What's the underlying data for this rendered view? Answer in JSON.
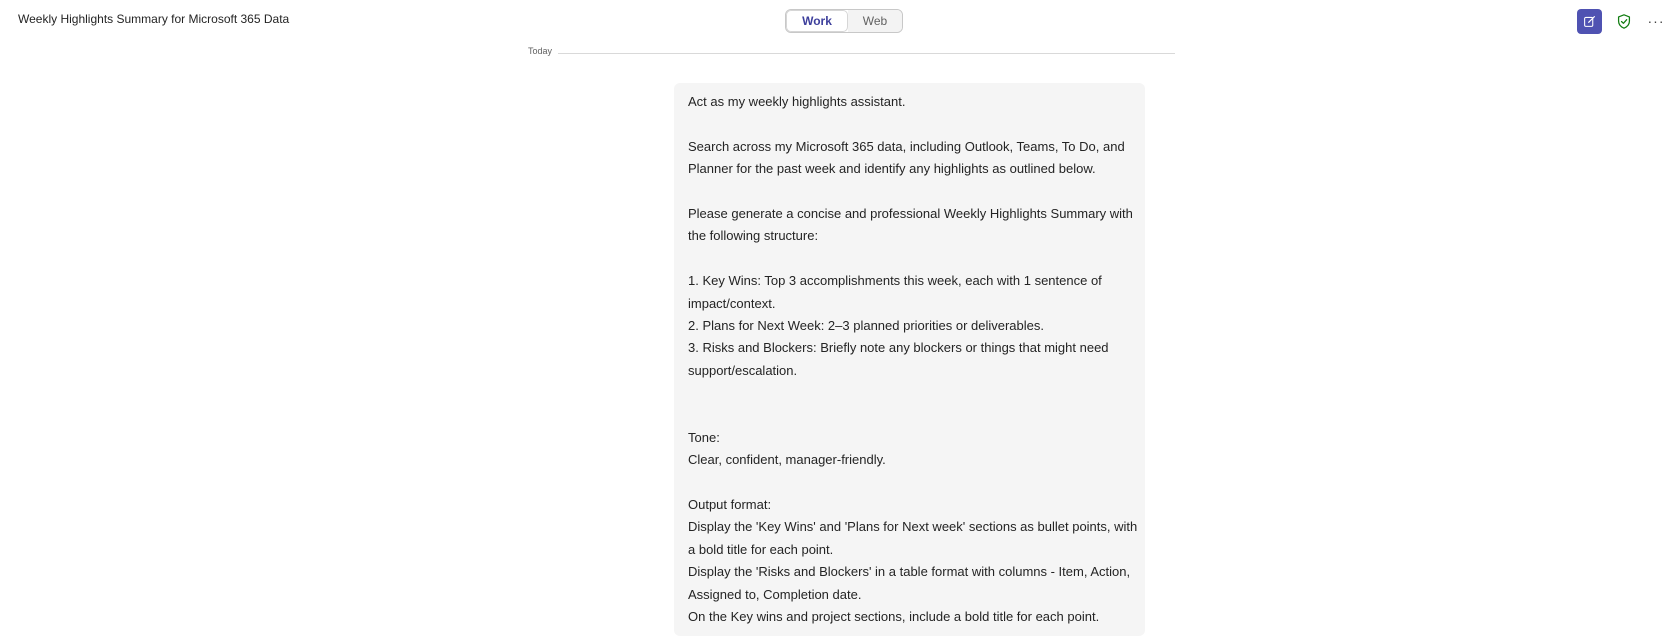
{
  "header": {
    "title": "Weekly Highlights Summary for Microsoft 365 Data",
    "toggle": {
      "work_label": "Work",
      "web_label": "Web",
      "selected": "Work"
    },
    "actions": {
      "new_chat_icon": "compose-icon",
      "shield_icon": "shield-check-icon",
      "more_icon": "more-icon",
      "more_label": "···"
    }
  },
  "conversation": {
    "date_label": "Today",
    "message": {
      "lines": [
        "Act as my weekly highlights assistant.",
        "",
        "Search across my Microsoft 365 data, including Outlook, Teams, To Do, and",
        "Planner for the past week and identify any highlights as outlined below.",
        "",
        "Please generate a concise and professional Weekly Highlights Summary with",
        "the following structure:",
        "",
        "1. Key Wins: Top 3 accomplishments this week, each with 1 sentence of",
        "impact/context.",
        "2. Plans for Next Week: 2–3 planned priorities or deliverables.",
        "3. Risks and Blockers: Briefly note any blockers or things that might need",
        "support/escalation.",
        "",
        "",
        "Tone:",
        "Clear, confident, manager-friendly.",
        "",
        "Output format:",
        "Display the 'Key Wins' and 'Plans for Next week' sections as bullet points, with",
        "a bold title for each point.",
        "Display the 'Risks and Blockers' in a table format with columns - Item, Action,",
        "Assigned to, Completion date.",
        "On the Key wins and project sections, include a bold title for each point."
      ]
    }
  },
  "colors": {
    "accent": "#4f52b2",
    "shield": "#107c10",
    "bubble": "#f5f5f5"
  }
}
